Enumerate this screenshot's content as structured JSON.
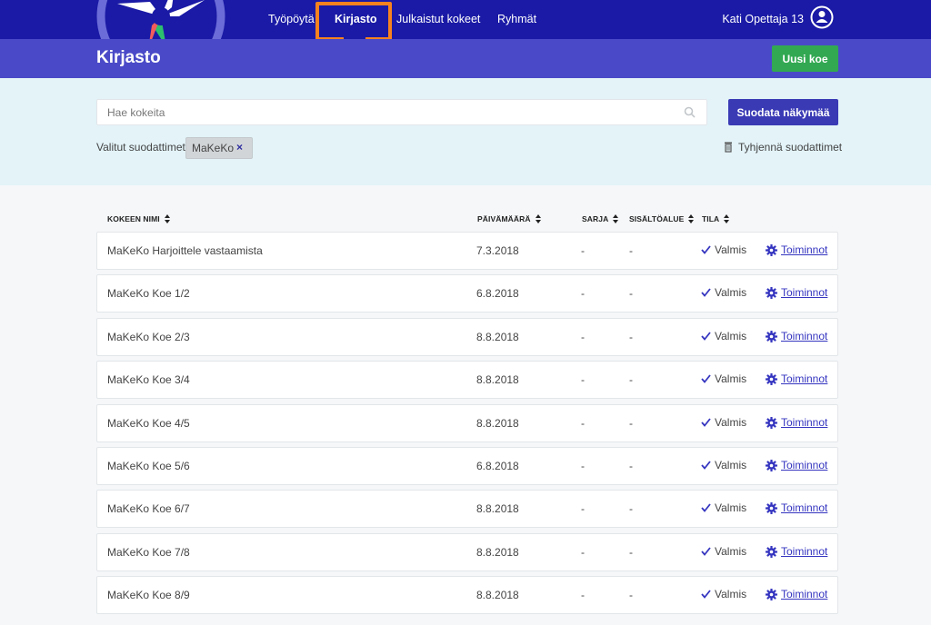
{
  "nav": {
    "items": [
      {
        "label": "Työpöytä",
        "active": false
      },
      {
        "label": "Kirjasto",
        "active": true
      },
      {
        "label": "Julkaistut kokeet",
        "active": false
      },
      {
        "label": "Ryhmät",
        "active": false
      }
    ],
    "user_name": "Kati Opettaja 13"
  },
  "header": {
    "title": "Kirjasto",
    "new_exam_label": "Uusi koe"
  },
  "filters": {
    "search_placeholder": "Hae kokeita",
    "filter_button_label": "Suodata näkymää",
    "selected_label": "Valitut suodattimet",
    "chips": [
      "MaKeKo"
    ],
    "chip_remove_symbol": "×",
    "clear_label": "Tyhjennä suodattimet"
  },
  "table": {
    "columns": [
      "KOKEEN NIMI",
      "PÄIVÄMÄÄRÄ",
      "SARJA",
      "SISÄLTÖALUE",
      "TILA"
    ],
    "action_label": "Toiminnot",
    "rows": [
      {
        "name": "MaKeKo Harjoittele vastaamista",
        "date": "7.3.2018",
        "series": "-",
        "area": "-",
        "status": "Valmis"
      },
      {
        "name": "MaKeKo Koe 1/2",
        "date": "6.8.2018",
        "series": "-",
        "area": "-",
        "status": "Valmis"
      },
      {
        "name": "MaKeKo Koe 2/3",
        "date": "8.8.2018",
        "series": "-",
        "area": "-",
        "status": "Valmis"
      },
      {
        "name": "MaKeKo Koe 3/4",
        "date": "8.8.2018",
        "series": "-",
        "area": "-",
        "status": "Valmis"
      },
      {
        "name": "MaKeKo Koe 4/5",
        "date": "8.8.2018",
        "series": "-",
        "area": "-",
        "status": "Valmis"
      },
      {
        "name": "MaKeKo Koe 5/6",
        "date": "6.8.2018",
        "series": "-",
        "area": "-",
        "status": "Valmis"
      },
      {
        "name": "MaKeKo Koe 6/7",
        "date": "8.8.2018",
        "series": "-",
        "area": "-",
        "status": "Valmis"
      },
      {
        "name": "MaKeKo Koe 7/8",
        "date": "8.8.2018",
        "series": "-",
        "area": "-",
        "status": "Valmis"
      },
      {
        "name": "MaKeKo Koe 8/9",
        "date": "8.8.2018",
        "series": "-",
        "area": "-",
        "status": "Valmis"
      }
    ]
  },
  "colors": {
    "nav_bg": "#1a1aa6",
    "subheader_bg": "#4a4ac8",
    "primary_button": "#3a3ab5",
    "success_button": "#32a852",
    "highlight": "#f6821f",
    "filter_panel_bg": "#e3f3f8"
  },
  "icons": {
    "logo": "pinwheel-logo",
    "user": "user-icon",
    "search": "search-icon",
    "trash": "trash-icon",
    "sort": "sort-icon",
    "status": "check-icon",
    "actions": "gear-icon"
  }
}
